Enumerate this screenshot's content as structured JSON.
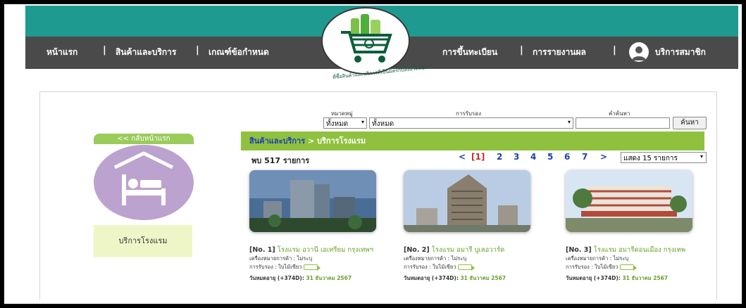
{
  "nav": {
    "left": [
      "หน้าแรก",
      "สินค้าและบริการ",
      "เกณฑ์ข้อกำหนด"
    ],
    "right": [
      "การขึ้นทะเบียน",
      "การรายงานผล",
      "บริการสมาชิก"
    ],
    "separator": "|"
  },
  "logo": {
    "caption": "ที่ซื้อสินค้าและบริการที่เป็นมิตรกับสิ่งแวดล้อม",
    "icon": "shopping-cart-logo"
  },
  "filters": {
    "category_label": "หมวดหมู่",
    "category_value": "ทั้งหมด",
    "certification_label": "การรับรอง",
    "certification_value": "ทั้งหมด",
    "keyword_label": "คำค้นหา",
    "keyword_value": "",
    "search_button": "ค้นหา"
  },
  "sidebar": {
    "back_label": "<< กลับหน้าแรก",
    "category_icon": "hotel-bed-icon",
    "category_name": "บริการโรงแรม"
  },
  "breadcrumb": {
    "parent": "สินค้าและบริการ",
    "separator": " > ",
    "current": "บริการโรงแรม"
  },
  "results": {
    "count_label": "พบ 517 รายการ",
    "pagination": {
      "prev": "<",
      "current": "[1]",
      "pages": [
        "2",
        "3",
        "4",
        "5",
        "6",
        "7"
      ],
      "next": ">"
    },
    "per_page": "แสดง 15 รายการ"
  },
  "cards": [
    {
      "no": "[No. 1]",
      "name": "โรงแรม อวานี เอเทรียม กรุงเทพฯ",
      "trademark": "เครื่องหมายการค้า : ไม่ระบุ",
      "certification": "การรับรอง : ใบไม้เขียว",
      "expiry_label": "วันหมดอายุ (+374D):",
      "expiry_date": "31 ธันวาคม 2567"
    },
    {
      "no": "[No. 2]",
      "name": "โรงแรม อมารี บูเลอวาร์ด",
      "trademark": "เครื่องหมายการค้า : ไม่ระบุ",
      "certification": "การรับรอง : ใบไม้เขียว",
      "expiry_label": "วันหมดอายุ (+374D):",
      "expiry_date": "31 ธันวาคม 2567"
    },
    {
      "no": "[No. 3]",
      "name": "โรงแรม อมารีดอนเมือง กรุงเทพ",
      "trademark": "เครื่องหมายการค้า : ไม่ระบุ",
      "certification": "การรับรอง : ใบไม้เขียว",
      "expiry_label": "วันหมดอายุ (+374D):",
      "expiry_date": "31 ธันวาคม 2567"
    }
  ],
  "colors": {
    "teal": "#1e9a91",
    "navbar": "#4a4a4a",
    "green": "#8fc13f",
    "link_green": "#6a9e2a",
    "purple": "#bca2cf",
    "page_blue": "#1f3fb5"
  }
}
